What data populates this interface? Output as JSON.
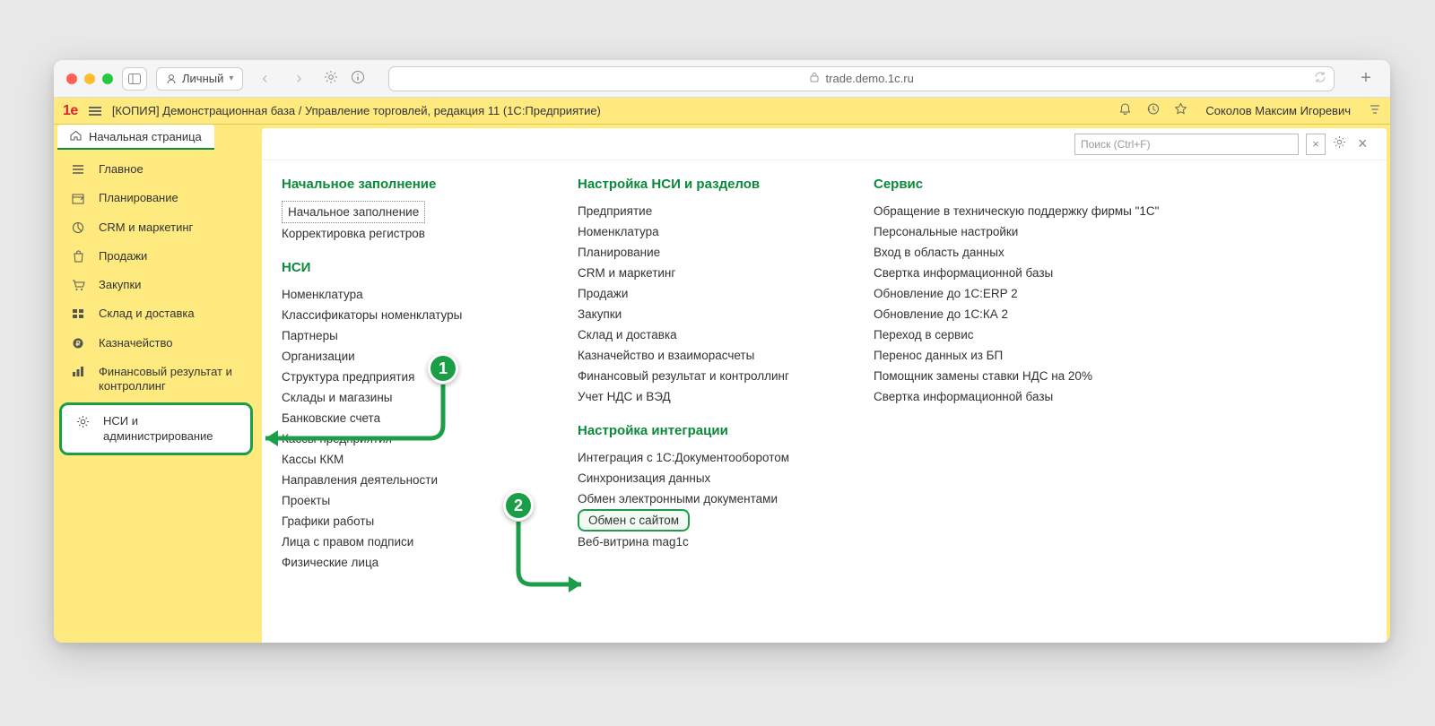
{
  "browser": {
    "profile_label": "Личный",
    "url": "trade.demo.1c.ru"
  },
  "app_header": {
    "title": "[КОПИЯ] Демонстрационная база / Управление торговлей, редакция 11  (1С:Предприятие)",
    "user": "Соколов Максим Игоревич"
  },
  "tab": {
    "home": "Начальная страница"
  },
  "sidebar": {
    "items": [
      {
        "label": "Главное",
        "icon": "menu"
      },
      {
        "label": "Планирование",
        "icon": "plan"
      },
      {
        "label": "CRM и маркетинг",
        "icon": "pie"
      },
      {
        "label": "Продажи",
        "icon": "bag"
      },
      {
        "label": "Закупки",
        "icon": "cart"
      },
      {
        "label": "Склад и доставка",
        "icon": "boxes"
      },
      {
        "label": "Казначейство",
        "icon": "ruble"
      },
      {
        "label": "Финансовый результат и контроллинг",
        "icon": "bars"
      },
      {
        "label": "НСИ и администрирование",
        "icon": "gear"
      }
    ]
  },
  "search": {
    "placeholder": "Поиск (Ctrl+F)"
  },
  "sections": {
    "col1": [
      {
        "heading": "Начальное заполнение",
        "items": [
          "Начальное заполнение",
          "Корректировка регистров"
        ]
      },
      {
        "heading": "НСИ",
        "items": [
          "Номенклатура",
          "Классификаторы номенклатуры",
          "Партнеры",
          "Организации",
          "Структура предприятия",
          "Склады и магазины",
          "Банковские счета",
          "Кассы предприятия",
          "Кассы ККМ",
          "Направления деятельности",
          "Проекты",
          "Графики работы",
          "Лица с правом подписи",
          "Физические лица"
        ]
      }
    ],
    "col2": [
      {
        "heading": "Настройка НСИ и разделов",
        "items": [
          "Предприятие",
          "Номенклатура",
          "Планирование",
          "CRM и маркетинг",
          "Продажи",
          "Закупки",
          "Склад и доставка",
          "Казначейство и взаиморасчеты",
          "Финансовый результат и контроллинг",
          "Учет НДС и ВЭД"
        ]
      },
      {
        "heading": "Настройка интеграции",
        "items": [
          "Интеграция с 1С:Документооборотом",
          "Синхронизация данных",
          "Обмен электронными документами",
          "Обмен с сайтом",
          "Веб-витрина mag1c"
        ]
      }
    ],
    "col3": [
      {
        "heading": "Сервис",
        "items": [
          "Обращение в техническую поддержку фирмы \"1С\"",
          "Персональные настройки",
          "Вход в область данных",
          "Свертка информационной базы",
          "Обновление до 1С:ERP 2",
          "Обновление до 1С:КА 2",
          "Переход в сервис",
          "Перенос данных из БП",
          "Помощник замены ставки НДС на 20%",
          "Свертка информационной базы"
        ]
      }
    ]
  },
  "callouts": {
    "b1": "1",
    "b2": "2"
  }
}
